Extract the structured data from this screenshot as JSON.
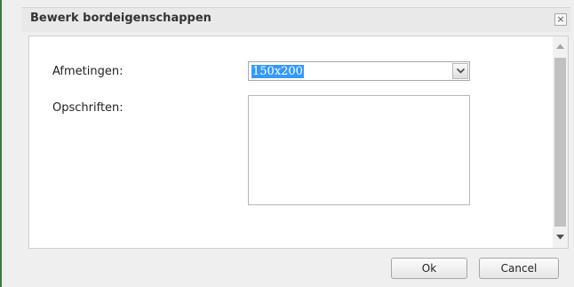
{
  "dialog": {
    "title": "Bewerk bordeigenschappen",
    "close_symbol": "×"
  },
  "form": {
    "dimensions_label": "Afmetingen:",
    "dimensions_value": "150x200",
    "captions_label": "Opschriften:",
    "captions_value": ""
  },
  "buttons": {
    "ok_label": "Ok",
    "cancel_label": "Cancel"
  },
  "icons": {
    "dropdown": "chevron-down-icon",
    "scroll_up": "arrow-up-icon",
    "scroll_down": "arrow-down-icon",
    "close": "close-icon"
  },
  "colors": {
    "selection_highlight": "#3399ff",
    "dialog_background": "#efefef"
  }
}
